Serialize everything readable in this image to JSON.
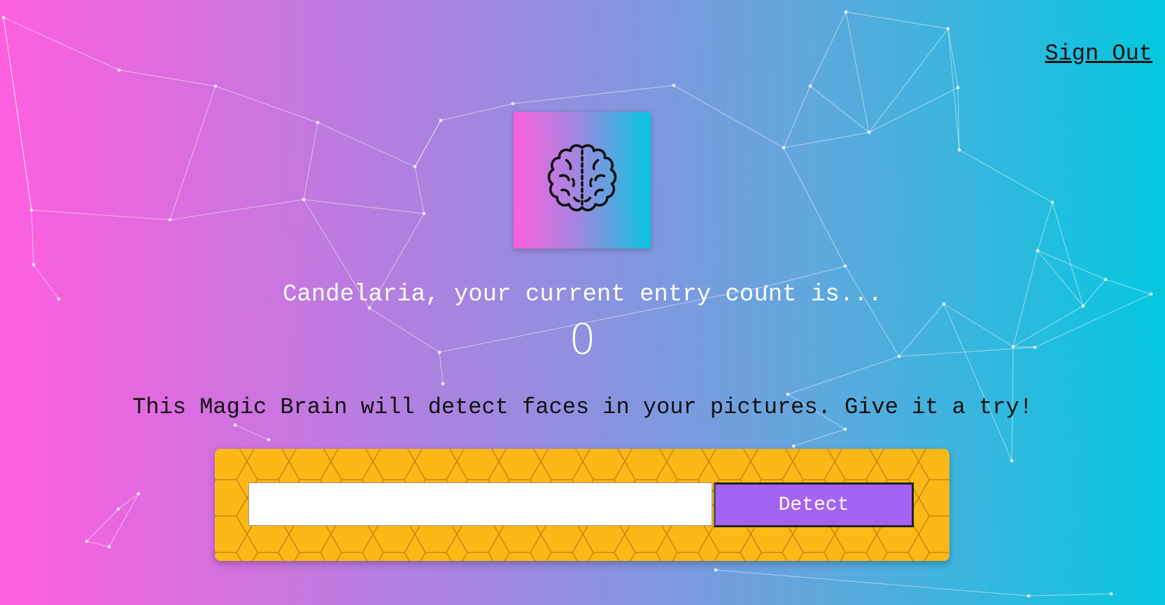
{
  "nav": {
    "signout_label": "Sign Out"
  },
  "logo": {
    "icon": "brain-icon"
  },
  "rank": {
    "greeting": "Candelaria, your current entry count is...",
    "count": "0"
  },
  "form": {
    "tagline": "This Magic Brain will detect faces in your pictures. Give it a try!",
    "input_value": "",
    "input_placeholder": "",
    "button_label": "Detect"
  },
  "colors": {
    "gradient_left": "#ff5edf",
    "gradient_right": "#04c8de",
    "panel": "#fcb817",
    "button": "#a463f2"
  }
}
